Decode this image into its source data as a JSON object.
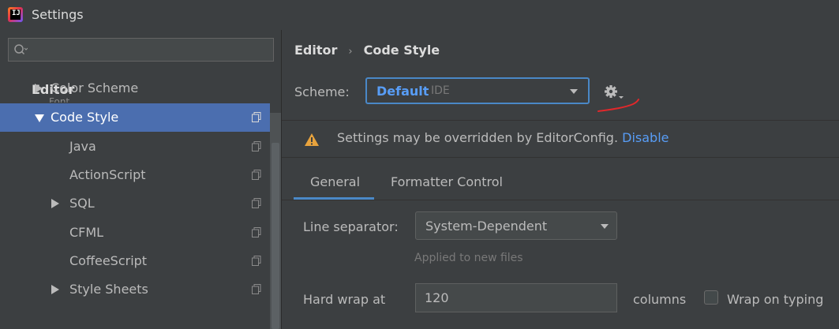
{
  "window": {
    "title": "Settings"
  },
  "sidebar": {
    "search": {
      "placeholder": ""
    },
    "section_header": "Editor",
    "ghost_item": "Font",
    "items": [
      {
        "label": "Color Scheme",
        "expand": "collapsed",
        "indent": 1
      },
      {
        "label": "Code Style",
        "expand": "expanded",
        "indent": 1,
        "selected": true
      },
      {
        "label": "Java",
        "expand": "none",
        "indent": 2
      },
      {
        "label": "ActionScript",
        "expand": "none",
        "indent": 2
      },
      {
        "label": "SQL",
        "expand": "collapsed",
        "indent": 2
      },
      {
        "label": "CFML",
        "expand": "none",
        "indent": 2
      },
      {
        "label": "CoffeeScript",
        "expand": "none",
        "indent": 2
      },
      {
        "label": "Style Sheets",
        "expand": "collapsed",
        "indent": 2
      }
    ]
  },
  "breadcrumb": {
    "parent": "Editor",
    "separator": "›",
    "current": "Code Style"
  },
  "scheme": {
    "label": "Scheme:",
    "name": "Default",
    "kind": "IDE"
  },
  "banner": {
    "text": "Settings may be overridden by EditorConfig.",
    "link": "Disable"
  },
  "tabs": [
    {
      "label": "General",
      "active": true
    },
    {
      "label": "Formatter Control",
      "active": false
    }
  ],
  "form": {
    "line_separator": {
      "label": "Line separator:",
      "value": "System-Dependent",
      "hint": "Applied to new files"
    },
    "hard_wrap": {
      "label": "Hard wrap at",
      "value": "120",
      "unit": "columns"
    },
    "wrap_on_typing": {
      "label": "Wrap on typing",
      "checked": false
    }
  },
  "colors": {
    "background": "#3c3f41",
    "selection": "#4b6eaf",
    "accent": "#4a88c7",
    "link": "#589df6",
    "warning": "#e8a33d",
    "annotation": "#e0282b"
  }
}
